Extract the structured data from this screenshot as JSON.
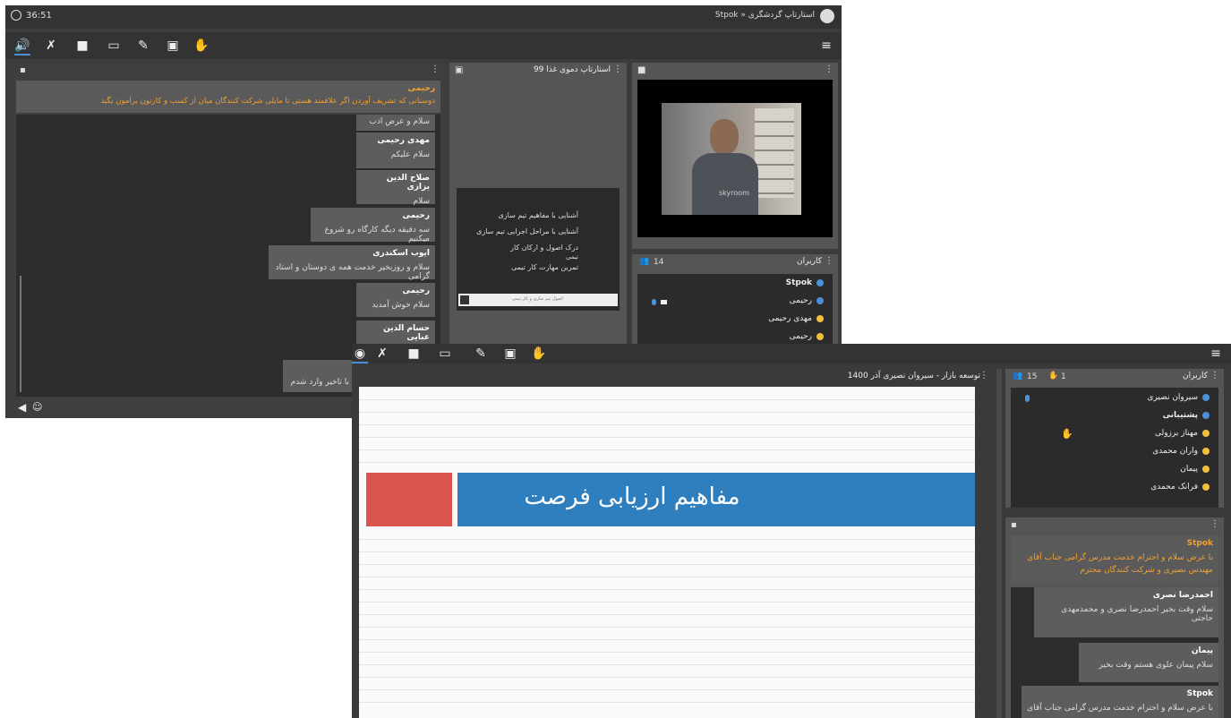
{
  "win1": {
    "timer": "36:51",
    "room_title": "Stpok » استارتاپ گردشگری",
    "chat": {
      "pinned_name": "رحیمی",
      "pinned_text": "دوستانی که تشریف آوردن اگر علاقمند هستی تا مایلی شرکت کنندگان میان از کسب و کارتون برامون بگید",
      "messages": [
        {
          "name": "",
          "text": "سلام و عرض ادب"
        },
        {
          "name": "مهدی رحیمی",
          "text": "سلام علیکم"
        },
        {
          "name": "صلاح الدین یزازی",
          "text": "سلام"
        },
        {
          "name": "رحیمی",
          "text": "سه دقیقه دیگه کارگاه رو شروع میکنیم"
        },
        {
          "name": "ایوب اسکندری",
          "text": "سلام و روزبخیر خدمت همه ی دوستان و استاد گرامی"
        },
        {
          "name": "رحیمی",
          "text": "سلام خوش آمدید"
        },
        {
          "name": "حسام الدین عبایی",
          "text": ""
        },
        {
          "name": "",
          "text": "با تاخیر وارد شدم"
        }
      ]
    },
    "presentation": {
      "title": "استارتاپ دموی غذا 99",
      "slide_lines": [
        "آشنایی با مفاهیم تیم سازی",
        "آشنایی با مراحل اجرایی تیم سازی",
        "درک اصول و ارکان کار",
        "تیمی",
        "تمرین مهارت کار تیمی"
      ],
      "footer_text": "اصول تیم سازی و کار تیمی"
    },
    "video": {
      "watermark": "skyroom"
    },
    "users": {
      "title": "کاربران",
      "count": "14",
      "list": [
        {
          "name": "Stpok",
          "color": "#4a90d9",
          "bold": true
        },
        {
          "name": "رحیمی",
          "color": "#4a90d9",
          "bold": false
        },
        {
          "name": "مهدی رحیمی",
          "color": "#f0c23a",
          "bold": false
        },
        {
          "name": "رحیمی",
          "color": "#f0c23a",
          "bold": false
        }
      ]
    }
  },
  "win2": {
    "presentation": {
      "title": "توسعه بازار - سیروان نصیری آذر 1400",
      "slide_heading": "مفاهیم ارزیابی فرصت"
    },
    "users": {
      "title": "کاربران",
      "count": "15",
      "hands": "1",
      "list": [
        {
          "name": "سیروان نصیری",
          "color": "#4a90d9",
          "bold": false
        },
        {
          "name": "پشتیبانی",
          "color": "#4a90d9",
          "bold": true
        },
        {
          "name": "مهناز برزولی",
          "color": "#f0c23a",
          "bold": false
        },
        {
          "name": "واران محمدی",
          "color": "#f0c23a",
          "bold": false
        },
        {
          "name": "پیمان",
          "color": "#f0c23a",
          "bold": false
        },
        {
          "name": "فرانک محمدی",
          "color": "#f0c23a",
          "bold": false
        }
      ]
    },
    "chat": {
      "pinned_name": "Stpok",
      "pinned_text": "با عرض سلام و احترام خدمت مدرس گرامی جناب آقای مهندس نصیری و شرکت کنندگان محترم",
      "messages": [
        {
          "name": "احمدرضا نصری",
          "text": "سلام وقت بخیر احمدرضا نصری و محمدمهدی حاجتی"
        },
        {
          "name": "پیمان",
          "text": "سلام پیمان علوی هستم وقت بخیر"
        },
        {
          "name": "Stpok",
          "text": "با عرض سلام و احترام خدمت مدرس گرامی جناب آقای"
        }
      ]
    }
  },
  "colors": {
    "accent_orange": "#f0a030",
    "accent_blue": "#2f7fbf",
    "accent_red": "#d9534f"
  }
}
